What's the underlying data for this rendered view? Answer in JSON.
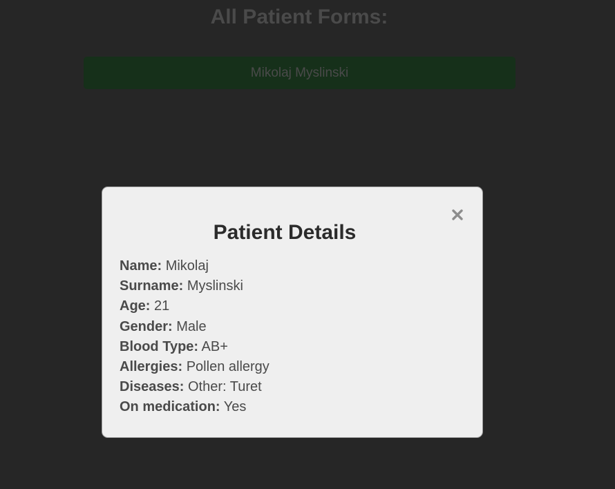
{
  "page": {
    "title": "All Patient Forms:"
  },
  "patient_list": [
    {
      "name": "Mikolaj Myslinski"
    }
  ],
  "modal": {
    "title": "Patient Details",
    "close_icon": "close-icon",
    "fields": [
      {
        "label": "Name:",
        "value": "Mikolaj"
      },
      {
        "label": "Surname:",
        "value": "Myslinski"
      },
      {
        "label": "Age:",
        "value": "21"
      },
      {
        "label": "Gender:",
        "value": "Male"
      },
      {
        "label": "Blood Type:",
        "value": "AB+"
      },
      {
        "label": "Allergies:",
        "value": "Pollen allergy"
      },
      {
        "label": "Diseases:",
        "value": "Other: Turet"
      },
      {
        "label": "On medication:",
        "value": "Yes"
      }
    ]
  },
  "colors": {
    "page_background": "#262626",
    "patient_bar": "#16301a",
    "modal_background": "#efefef",
    "dimmed_text": "#4a4a4a"
  }
}
